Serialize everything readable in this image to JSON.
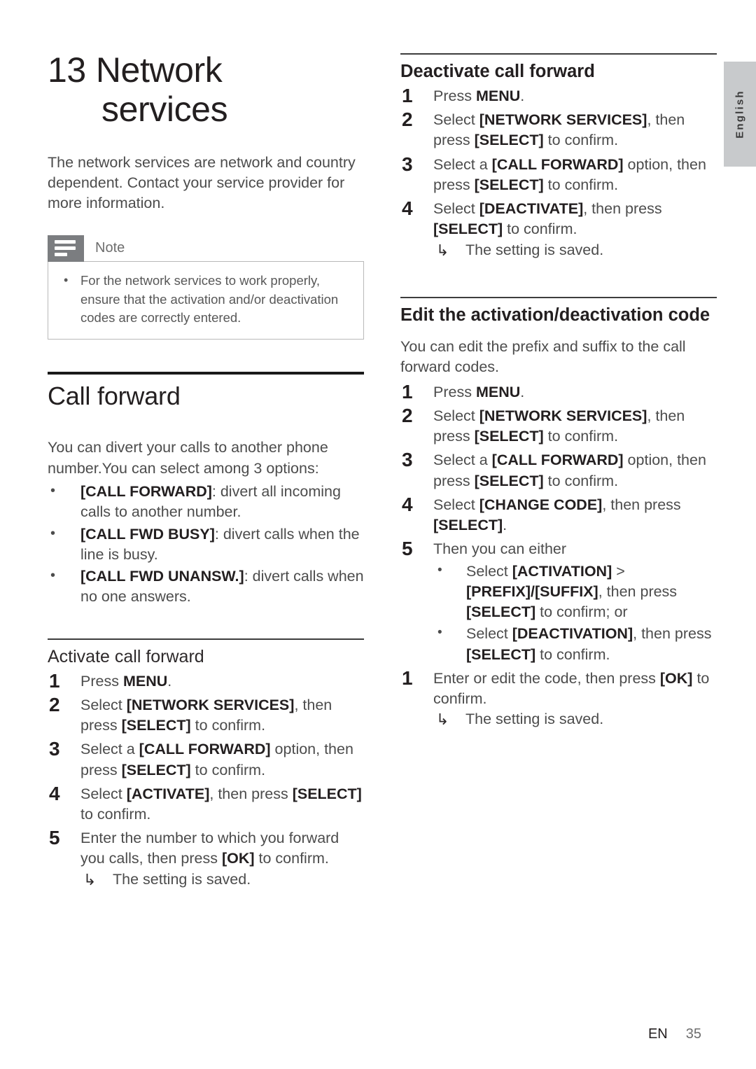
{
  "language_tab": {
    "label": "English"
  },
  "chapter": {
    "number": "13",
    "title_line1": "Network",
    "title_line2": "services"
  },
  "intro": "The network services are network and country dependent. Contact your service provider for more information.",
  "note": {
    "icon": "note-icon",
    "title": "Note",
    "items": [
      "For the network services to work properly, ensure that the activation and/or deactivation codes are correctly entered."
    ]
  },
  "call_forward": {
    "heading": "Call forward",
    "intro": "You can divert your calls to another phone number.You can select among 3 options:",
    "options": [
      {
        "key": "[CALL FORWARD]",
        "desc": ": divert all incoming calls to another number."
      },
      {
        "key": "[CALL FWD BUSY]",
        "desc": ": divert calls when the line is busy."
      },
      {
        "key": "[CALL FWD UNANSW.]",
        "desc": ": divert calls when no one answers."
      }
    ]
  },
  "activate": {
    "heading": "Activate call forward",
    "steps": [
      {
        "num": "1",
        "pre": "Press ",
        "key": "MENU",
        "post": "."
      },
      {
        "num": "2",
        "pre": "Select ",
        "key": "[NETWORK SERVICES]",
        "mid": ", then press ",
        "key2": "[SELECT]",
        "post": " to confirm."
      },
      {
        "num": "3",
        "pre": "Select a ",
        "key": "[CALL FORWARD]",
        "mid": " option, then press ",
        "key2": "[SELECT]",
        "post": " to confirm."
      },
      {
        "num": "4",
        "pre": "Select ",
        "key": "[ACTIVATE]",
        "mid": ", then press ",
        "key2": "[SELECT]",
        "post": " to confirm."
      },
      {
        "num": "5",
        "pre": "Enter the number to which you forward you calls, then press ",
        "key": "[OK]",
        "post": " to confirm.",
        "result": "The setting is saved."
      }
    ]
  },
  "deactivate": {
    "heading": "Deactivate call forward",
    "steps": [
      {
        "num": "1",
        "pre": "Press ",
        "key": "MENU",
        "post": "."
      },
      {
        "num": "2",
        "pre": "Select ",
        "key": "[NETWORK SERVICES]",
        "mid": ", then press ",
        "key2": "[SELECT]",
        "post": " to confirm."
      },
      {
        "num": "3",
        "pre": "Select a ",
        "key": "[CALL FORWARD]",
        "mid": " option, then press ",
        "key2": "[SELECT]",
        "post": " to confirm."
      },
      {
        "num": "4",
        "pre": "Select ",
        "key": "[DEACTIVATE]",
        "mid": ", then press ",
        "key2": "[SELECT]",
        "post": " to confirm.",
        "result": "The setting is saved."
      }
    ]
  },
  "edit_code": {
    "heading": "Edit the activation/deactivation code",
    "intro": "You can edit the prefix and suffix to the call forward codes.",
    "steps": [
      {
        "num": "1",
        "pre": "Press ",
        "key": "MENU",
        "post": "."
      },
      {
        "num": "2",
        "pre": "Select ",
        "key": "[NETWORK SERVICES]",
        "mid": ", then press ",
        "key2": "[SELECT]",
        "post": " to confirm."
      },
      {
        "num": "3",
        "pre": "Select a ",
        "key": "[CALL FORWARD]",
        "mid": " option, then press ",
        "key2": "[SELECT]",
        "post": " to confirm."
      },
      {
        "num": "4",
        "pre": "Select ",
        "key": "[CHANGE CODE]",
        "mid": ", then press ",
        "key2": "[SELECT]",
        "post": "."
      },
      {
        "num": "5",
        "pre": "Then you can either",
        "sub_bullets": [
          {
            "pre": "Select ",
            "key": "[ACTIVATION]",
            "mid": " > ",
            "key2": "[PREFIX]/[SUFFIX]",
            "mid2": ", then press ",
            "key3": "[SELECT]",
            "post": " to confirm; or"
          },
          {
            "pre": "Select ",
            "key": "[DEACTIVATION]",
            "mid": ", then press ",
            "key2": "[SELECT]",
            "post": " to confirm."
          }
        ]
      },
      {
        "num": "1",
        "pre": "Enter or edit the code, then press ",
        "key": "[OK]",
        "post": " to confirm.",
        "result": "The setting is saved."
      }
    ]
  },
  "footer": {
    "lang_code": "EN",
    "page_number": "35"
  }
}
